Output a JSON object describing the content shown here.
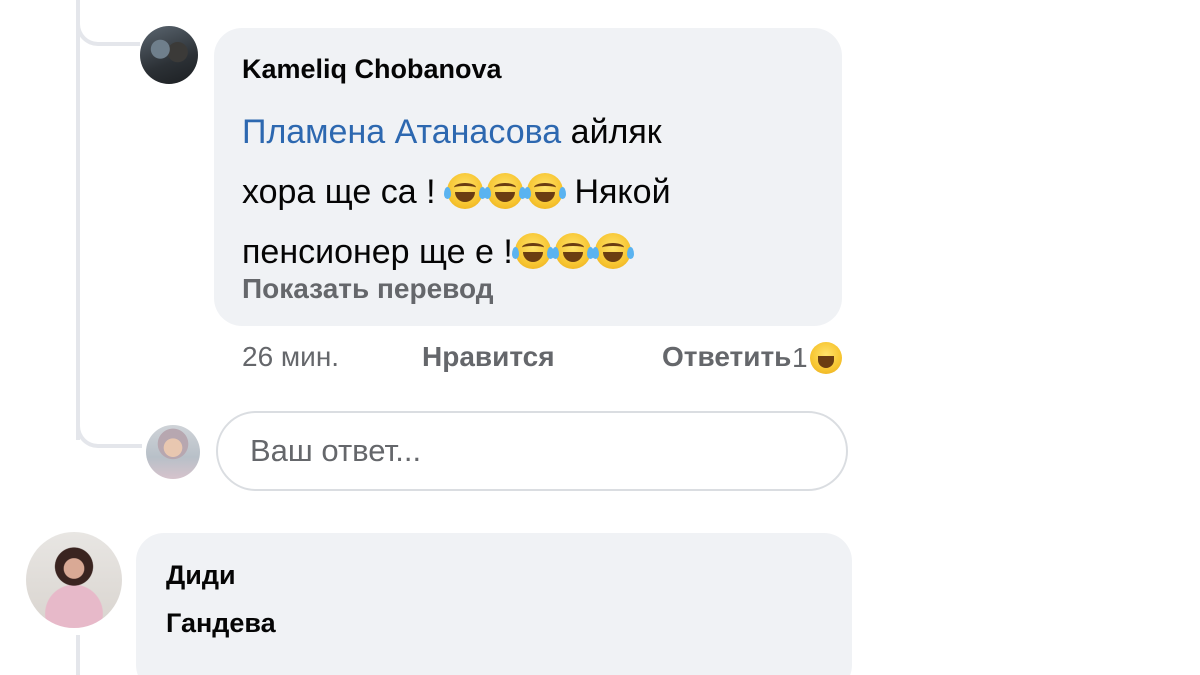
{
  "comment": {
    "author": "Kameliq Chobanova",
    "mention": "Пламена Атанасова",
    "text_line1_rest": "айляк",
    "text_line2_a": "хора ще са !",
    "text_line2_b": "Някой",
    "text_line3": "пенсионер ще е !",
    "emoji_name": "face-with-tears-of-joy",
    "see_translation": "Показать перевод",
    "time": "26 мин.",
    "like_label": "Нравится",
    "reply_label": "Ответить",
    "reaction_count": "1",
    "reaction_emoji": "laughing-face"
  },
  "reply_input": {
    "placeholder": "Ваш ответ..."
  },
  "next_comment": {
    "author_line1": "Диди",
    "author_line2": "Гандева"
  }
}
